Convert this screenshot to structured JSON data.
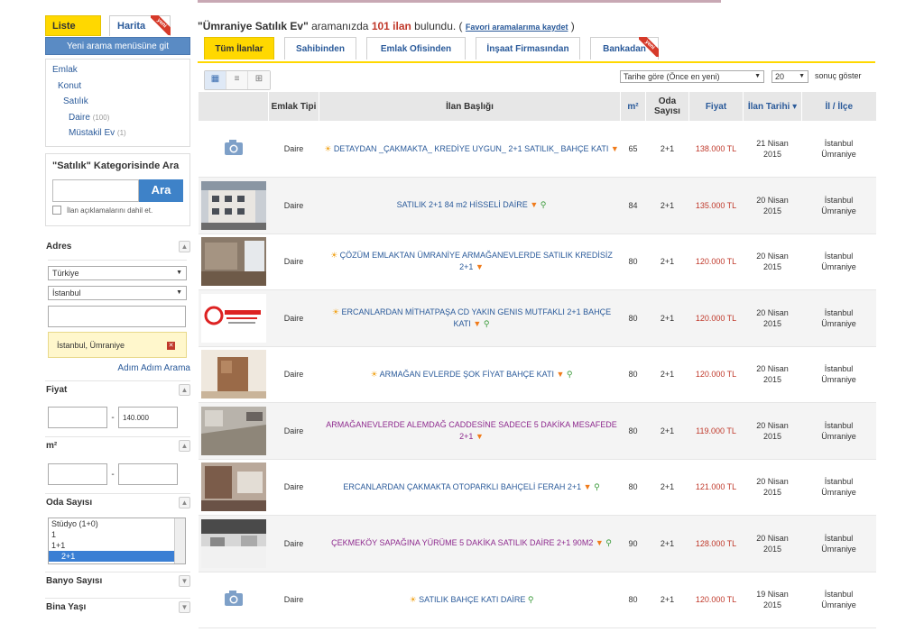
{
  "sidebar": {
    "view_tabs": {
      "list": "Liste",
      "map": "Harita",
      "map_badge": "yeni"
    },
    "new_search": "Yeni arama menüsüne git",
    "categories": [
      {
        "label": "Emlak",
        "count": ""
      },
      {
        "label": "Konut",
        "count": ""
      },
      {
        "label": "Satılık",
        "count": ""
      },
      {
        "label": "Daire",
        "count": "(100)"
      },
      {
        "label": "Müstakil Ev",
        "count": "(1)"
      }
    ],
    "search": {
      "title": "\"Satılık\" Kategorisinde Ara",
      "button": "Ara",
      "checkbox_label": "İlan açıklamalarını dahil et."
    },
    "address": {
      "label": "Adres",
      "country": "Türkiye",
      "city": "İstanbul",
      "selected": "İstanbul, Ümraniye",
      "step_link": "Adım Adım Arama"
    },
    "price": {
      "label": "Fiyat",
      "min": "",
      "max": "140.000"
    },
    "area": {
      "label": "m²",
      "min": "",
      "max": ""
    },
    "rooms": {
      "label": "Oda Sayısı",
      "options": [
        "Stüdyo (1+0)",
        "1",
        "1+1",
        "2+1"
      ],
      "selected": "2+1"
    },
    "bathrooms": {
      "label": "Banyo Sayısı"
    },
    "building_age": {
      "label": "Bina Yaşı"
    }
  },
  "results": {
    "query": "\"Ümraniye Satılık Ev\"",
    "mid_text": " aramanızda ",
    "count": "101 ilan",
    "found": " bulundu. ( ",
    "save_link": "Favori aramalarıma kaydet",
    "close": " )"
  },
  "seller_tabs": [
    {
      "label": "Tüm İlanlar",
      "badge": ""
    },
    {
      "label": "Sahibinden",
      "badge": ""
    },
    {
      "label": "Emlak Ofisinden",
      "badge": ""
    },
    {
      "label": "İnşaat Firmasından",
      "badge": ""
    },
    {
      "label": "Bankadan",
      "badge": "yeni"
    }
  ],
  "toolbar": {
    "sort": "Tarihe göre (Önce en yeni)",
    "page_size": "20",
    "page_size_label": "sonuç göster"
  },
  "columns": [
    "Emlak Tipi",
    "İlan Başlığı",
    "m²",
    "Oda Sayısı",
    "Fiyat",
    "İlan Tarihi",
    "İl / İlçe"
  ],
  "listings": [
    {
      "thumb": "camera",
      "type": "Daire",
      "title": "DETAYDAN _ÇAKMAKTA_ KREDİYE UYGUN_ 2+1 SATILIK_ BAHÇE KATI",
      "sun": true,
      "pin": true,
      "map": false,
      "visited": false,
      "m2": "65",
      "rooms": "2+1",
      "price": "138.000 TL",
      "date1": "21 Nisan",
      "date2": "2015",
      "city": "İstanbul",
      "district": "Ümraniye"
    },
    {
      "thumb": "building",
      "type": "Daire",
      "title": "SATILIK 2+1 84 m2 HİSSELİ DAİRE",
      "sun": false,
      "pin": true,
      "map": true,
      "visited": false,
      "m2": "84",
      "rooms": "2+1",
      "price": "135.000 TL",
      "date1": "20 Nisan",
      "date2": "2015",
      "city": "İstanbul",
      "district": "Ümraniye"
    },
    {
      "thumb": "room",
      "type": "Daire",
      "title": "ÇÖZÜM EMLAKTAN ÜMRANİYE ARMAĞANEVLERDE SATILIK KREDİSİZ 2+1",
      "sun": true,
      "pin": true,
      "map": false,
      "visited": false,
      "m2": "80",
      "rooms": "2+1",
      "price": "120.000 TL",
      "date1": "20 Nisan",
      "date2": "2015",
      "city": "İstanbul",
      "district": "Ümraniye"
    },
    {
      "thumb": "logo",
      "type": "Daire",
      "title": "ERCANLARDAN MİTHATPAŞA CD YAKIN GENIS MUTFAKLI 2+1 BAHÇE KATI",
      "sun": true,
      "pin": true,
      "map": true,
      "visited": false,
      "m2": "80",
      "rooms": "2+1",
      "price": "120.000 TL",
      "date1": "20 Nisan",
      "date2": "2015",
      "city": "İstanbul",
      "district": "Ümraniye"
    },
    {
      "thumb": "door",
      "type": "Daire",
      "title": "ARMAĞAN EVLERDE ŞOK FİYAT BAHÇE KATI",
      "sun": true,
      "pin": true,
      "map": true,
      "visited": false,
      "m2": "80",
      "rooms": "2+1",
      "price": "120.000 TL",
      "date1": "20 Nisan",
      "date2": "2015",
      "city": "İstanbul",
      "district": "Ümraniye"
    },
    {
      "thumb": "floor",
      "type": "Daire",
      "title": "ARMAĞANEVLERDE ALEMDAĞ CADDESİNE SADECE 5 DAKİKA MESAFEDE 2+1",
      "sun": false,
      "pin": true,
      "map": false,
      "visited": true,
      "m2": "80",
      "rooms": "2+1",
      "price": "119.000 TL",
      "date1": "20 Nisan",
      "date2": "2015",
      "city": "İstanbul",
      "district": "Ümraniye"
    },
    {
      "thumb": "kitchen",
      "type": "Daire",
      "title": "ERCANLARDAN ÇAKMAKTA OTOPARKLI BAHÇELİ FERAH 2+1",
      "sun": false,
      "pin": true,
      "map": true,
      "visited": false,
      "m2": "80",
      "rooms": "2+1",
      "price": "121.000 TL",
      "date1": "20 Nisan",
      "date2": "2015",
      "city": "İstanbul",
      "district": "Ümraniye"
    },
    {
      "thumb": "kitchen2",
      "type": "Daire",
      "title": "ÇEKMEKÖY SAPAĞINA YÜRÜME 5 DAKİKA SATILIK DAİRE 2+1 90M2",
      "sun": false,
      "pin": true,
      "map": true,
      "visited": true,
      "m2": "90",
      "rooms": "2+1",
      "price": "128.000 TL",
      "date1": "20 Nisan",
      "date2": "2015",
      "city": "İstanbul",
      "district": "Ümraniye"
    },
    {
      "thumb": "camera",
      "type": "Daire",
      "title": "SATILIK BAHÇE KATI DAİRE",
      "sun": true,
      "pin": false,
      "map": true,
      "visited": false,
      "m2": "80",
      "rooms": "2+1",
      "price": "120.000 TL",
      "date1": "19 Nisan",
      "date2": "2015",
      "city": "İstanbul",
      "district": "Ümraniye"
    }
  ],
  "colors": {
    "accent": "#ffd800",
    "link": "#2a5a9a",
    "price": "#c0392b",
    "visited": "#8e2a8e",
    "button": "#3e82c8"
  }
}
